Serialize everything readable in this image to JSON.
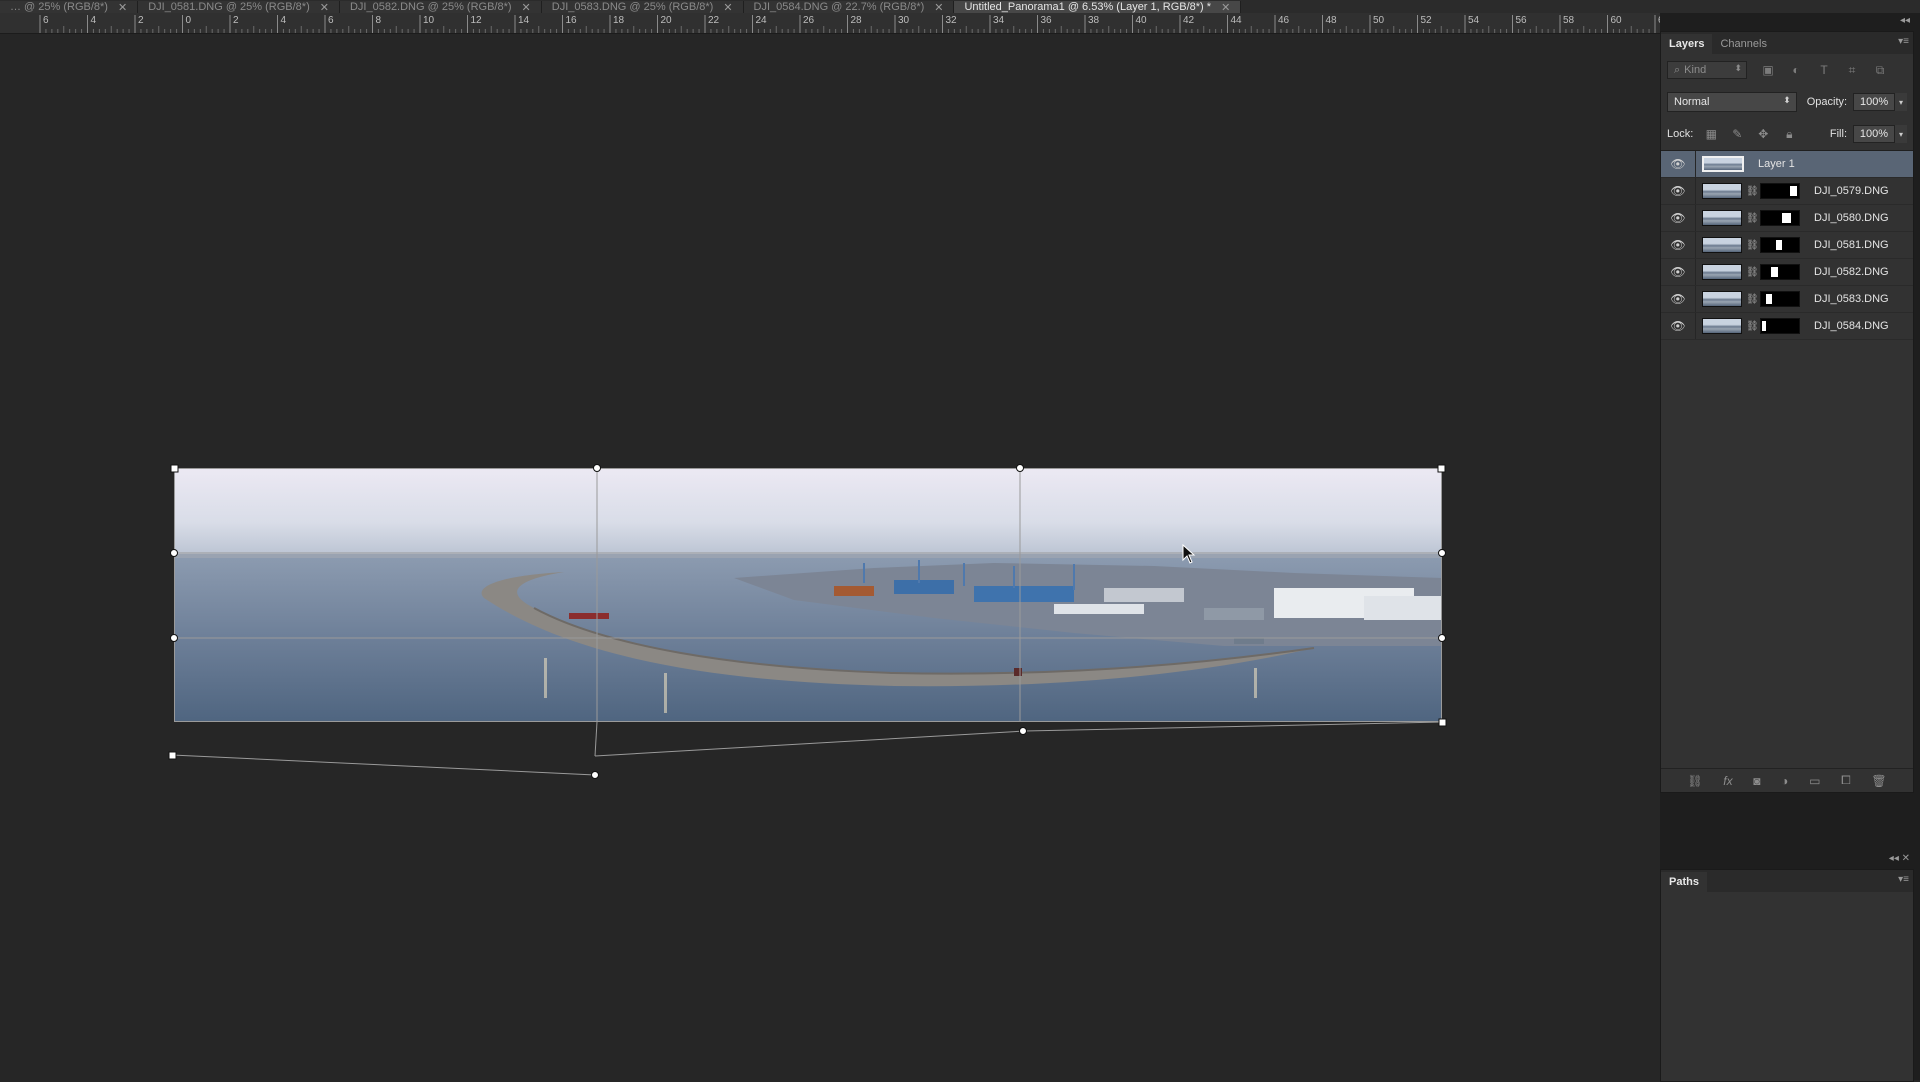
{
  "tabs": [
    {
      "label": "… @ 25% (RGB/8*)",
      "active": false
    },
    {
      "label": "DJI_0581.DNG @ 25% (RGB/8*)",
      "active": false
    },
    {
      "label": "DJI_0582.DNG @ 25% (RGB/8*)",
      "active": false
    },
    {
      "label": "DJI_0583.DNG @ 25% (RGB/8*)",
      "active": false
    },
    {
      "label": "DJI_0584.DNG @ 22.7% (RGB/8*)",
      "active": false
    },
    {
      "label": "Untitled_Panorama1 @ 6.53% (Layer 1, RGB/8*) *",
      "active": true
    }
  ],
  "tab_close_glyph": "✕",
  "ruler_labels": [
    "6",
    "4",
    "2",
    "0",
    "2",
    "4",
    "6",
    "8",
    "10",
    "12",
    "14",
    "16",
    "18",
    "20",
    "22",
    "24",
    "26",
    "28",
    "30",
    "32",
    "34",
    "36",
    "38",
    "40",
    "42",
    "44",
    "46",
    "48",
    "50",
    "52",
    "54",
    "56",
    "58",
    "60",
    "6"
  ],
  "layers_panel": {
    "tabs": [
      "Layers",
      "Channels"
    ],
    "kind_label": "Kind",
    "blend_mode": "Normal",
    "opacity_label": "Opacity:",
    "opacity_value": "100%",
    "lock_label": "Lock:",
    "fill_label": "Fill:",
    "fill_value": "100%",
    "layers": [
      {
        "name": "Layer 1",
        "selected": true,
        "has_mask": false,
        "mask_fill": null
      },
      {
        "name": "DJI_0579.DNG",
        "selected": false,
        "has_mask": true,
        "mask_fill": [
          0.75,
          0.95
        ]
      },
      {
        "name": "DJI_0580.DNG",
        "selected": false,
        "has_mask": true,
        "mask_fill": [
          0.55,
          0.8
        ]
      },
      {
        "name": "DJI_0581.DNG",
        "selected": false,
        "has_mask": true,
        "mask_fill": [
          0.4,
          0.55
        ]
      },
      {
        "name": "DJI_0582.DNG",
        "selected": false,
        "has_mask": true,
        "mask_fill": [
          0.25,
          0.45
        ]
      },
      {
        "name": "DJI_0583.DNG",
        "selected": false,
        "has_mask": true,
        "mask_fill": [
          0.12,
          0.28
        ]
      },
      {
        "name": "DJI_0584.DNG",
        "selected": false,
        "has_mask": true,
        "mask_fill": [
          0.02,
          0.12
        ]
      }
    ]
  },
  "paths_panel": {
    "tabs": [
      "Paths"
    ]
  }
}
